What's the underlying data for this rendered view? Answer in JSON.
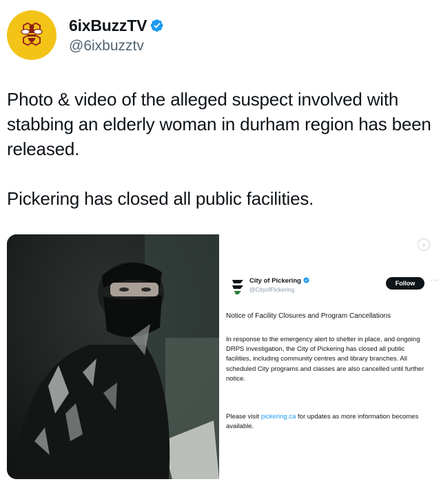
{
  "author": {
    "display_name": "6ixBuzzTV",
    "handle": "@6ixbuzztv",
    "verified": true,
    "avatar_icon": "bee-logo-icon",
    "avatar_color": "#f3c318",
    "verified_color": "#1d9bf0"
  },
  "tweet": {
    "paragraph_1": "Photo & video of the alleged suspect involved with stabbing an elderly woman in durham region has been released.",
    "paragraph_2": "Pickering has closed all public facilities."
  },
  "media": {
    "photo_icon": "suspect-photo",
    "next_icon": "chevron-right-icon",
    "next_label": "›",
    "embedded": {
      "name": "City of Pickering",
      "handle": "@CityofPickering",
      "follow_label": "Follow",
      "more_label": "···",
      "title": "Notice of Facility Closures and Program Cancellations",
      "body": "In response to the emergency alert to shelter in place, and ongoing DRPS investigation, the City of Pickering has closed all public facilities, including community centres and library branches. All scheduled City programs and classes are also cancelled until further notice.",
      "footer_before": "Please visit ",
      "footer_link": "pickering.ca",
      "footer_after": " for updates as more information becomes available."
    }
  }
}
